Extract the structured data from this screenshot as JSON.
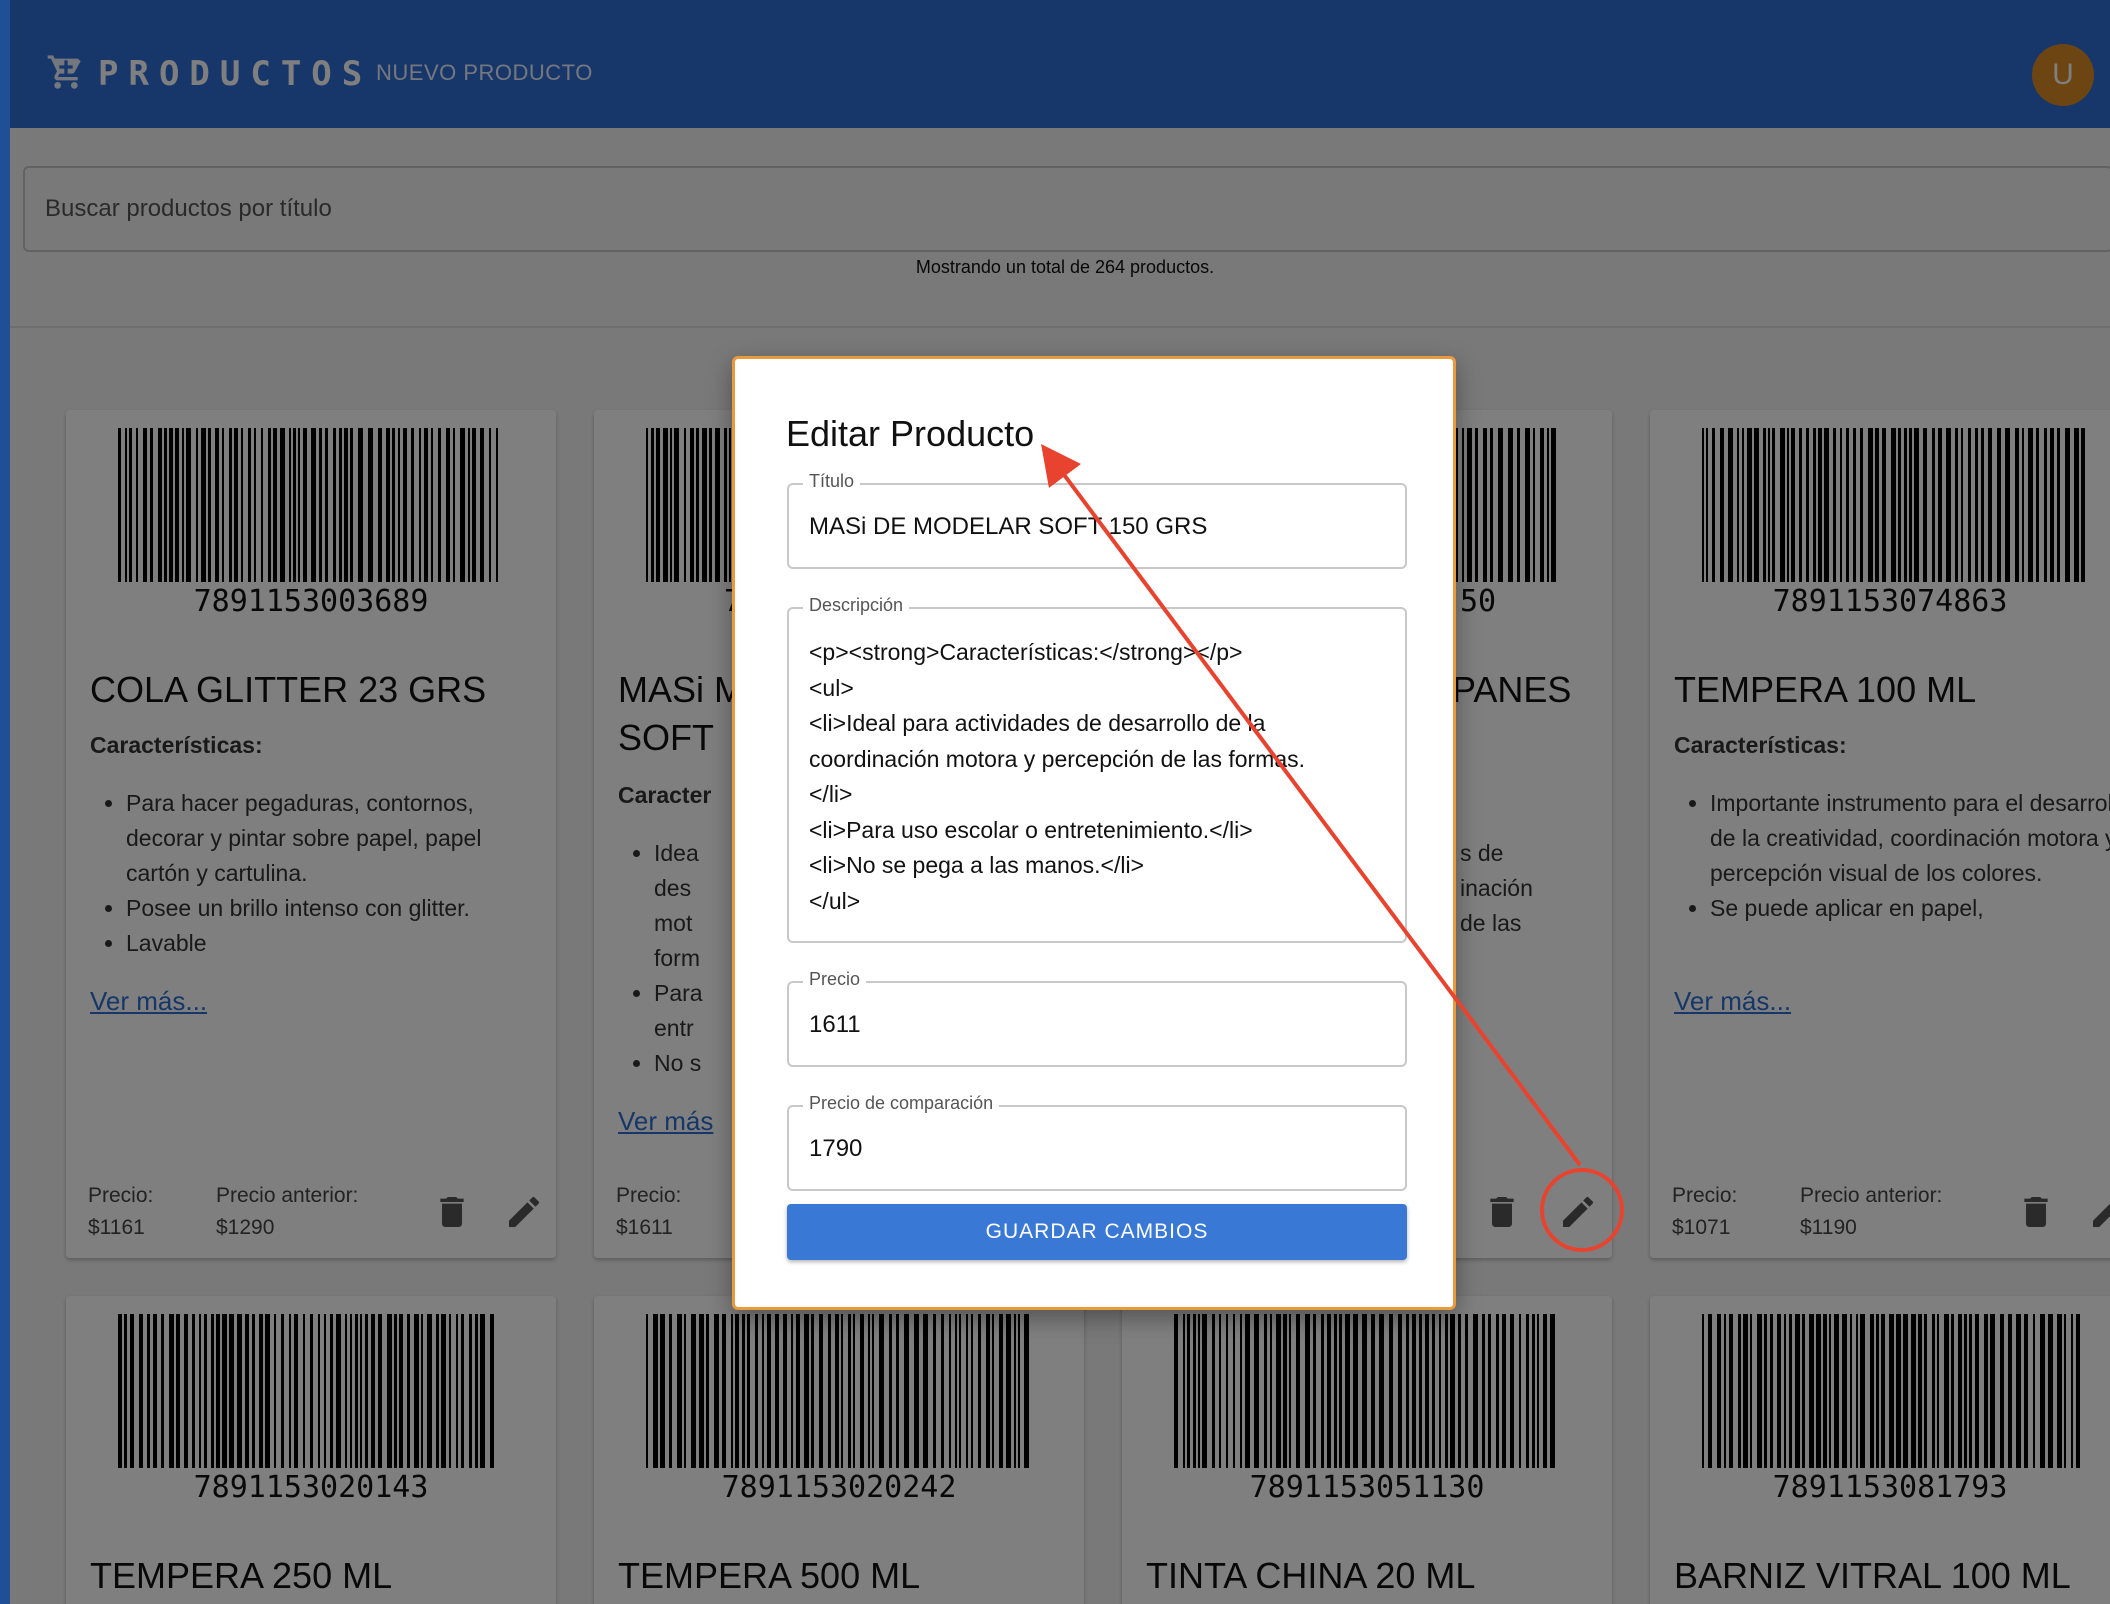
{
  "header": {
    "brand": "PRODUCTOS",
    "nav_new": "NUEVO PRODUCTO",
    "avatar_initial": "U",
    "cart_icon": "shopping-cart-icon"
  },
  "search": {
    "placeholder": "Buscar productos por título"
  },
  "summary": "Mostrando un total de 264 productos.",
  "cards": [
    {
      "barcode": "7891153003689",
      "title": "COLA GLITTER 23 GRS",
      "features_heading": "Características:",
      "features": [
        "Para hacer pegaduras, contornos, decorar y pintar sobre papel, papel cartón y cartulina.",
        "Posee un brillo intenso con glitter.",
        "Lavable"
      ],
      "more": "Ver más...",
      "price_label": "Precio:",
      "price": "$1161",
      "prev_label": "Precio anterior:",
      "prev_price": "$1290"
    },
    {
      "barcode_partial": "7",
      "title_line1": "MASi M",
      "title_line2": "SOFT",
      "features_heading": "Caracter",
      "features": [
        "Idea",
        "des",
        "mot",
        "form",
        "Para",
        "entr",
        "No s"
      ],
      "more": "Ver más",
      "price_label": "Precio:",
      "price": "$1611"
    },
    {
      "barcode_partial": "50",
      "title_partial": "PANES",
      "fragments": [
        "s de",
        "inación",
        "de las"
      ]
    },
    {
      "barcode": "7891153074863",
      "title": "TEMPERA 100 ML",
      "features_heading": "Características:",
      "features": [
        "Importante instrumento para el desarrollo de la creatividad, coordinación motora y percepción visual de los colores.",
        "Se puede aplicar en papel,"
      ],
      "more": "Ver más...",
      "price_label": "Precio:",
      "price": "$1071",
      "prev_label": "Precio anterior:",
      "prev_price": "$1190"
    }
  ],
  "cards_row2": [
    {
      "barcode": "7891153020143",
      "title": "TEMPERA 250 ML"
    },
    {
      "barcode": "7891153020242",
      "title": "TEMPERA 500 ML"
    },
    {
      "barcode": "7891153051130",
      "title": "TINTA CHINA 20 ML"
    },
    {
      "barcode": "7891153081793",
      "title": "BARNIZ VITRAL 100 ML"
    }
  ],
  "modal": {
    "title": "Editar Producto",
    "title_label": "Título",
    "title_value": "MASi DE MODELAR SOFT 150 GRS",
    "desc_label": "Descripción",
    "desc_value": "<p><strong>Características:</strong></p>\n<ul>\n<li>Ideal para actividades de desarrollo de la coordinación motora y percepción de las formas.\n</li>\n<li>Para uso escolar o entretenimiento.</li>\n<li>No se pega a las manos.</li>\n</ul>",
    "price_label": "Precio",
    "price_value": "1611",
    "compare_label": "Precio de comparación",
    "compare_value": "1790",
    "save_label": "GUARDAR CAMBIOS"
  },
  "colors": {
    "appbar": "#2f6ed6",
    "accent": "#3a78d6",
    "annotation": "#e8432e",
    "modal_border": "#e89a3c"
  }
}
